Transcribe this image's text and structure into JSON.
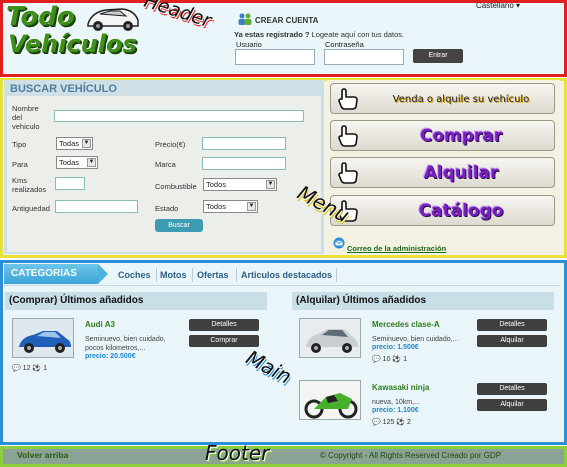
{
  "header": {
    "logo_line1": "Todo",
    "logo_line2": "Vehículos",
    "zone_label": "Header",
    "language": "Castellano ▾",
    "create_account": "CREAR CUENTA",
    "registered_prefix": "Ya estas registrado ?",
    "registered_suffix": " Logeate aquí con tus datos.",
    "user_label": "Usuario",
    "password_label": "Contraseña",
    "user_value": "",
    "password_value": "",
    "enter_label": "Entrar"
  },
  "search": {
    "title": "BUSCAR VEHÍCULO",
    "name_label": "Nombre del vehiculo",
    "name_value": "",
    "tipo_label": "Tipo",
    "tipo_value": "Todas",
    "para_label": "Para",
    "para_value": "Todas",
    "kms_label": "Kms realizados",
    "kms_value": "",
    "antiguedad_label": "Antiguedad",
    "antiguedad_value": "",
    "precio_label": "Precio(€)",
    "precio_value": "",
    "marca_label": "Marca",
    "marca_value": "",
    "combustible_label": "Combustible",
    "combustible_value": "Todos",
    "estado_label": "Estado",
    "estado_value": "Todos",
    "search_button": "Buscar"
  },
  "menu": {
    "zone_label": "Menu",
    "items": [
      {
        "label": "Venda o alquile su vehículo"
      },
      {
        "label": "Comprar"
      },
      {
        "label": "Alquilar"
      },
      {
        "label": "Catálogo"
      }
    ],
    "admin_mail": "Correo de la administración"
  },
  "main": {
    "zone_label": "Main",
    "categories_tab": "CATEGORIAS",
    "nav": [
      "Coches",
      "Motos",
      "Ofertas",
      "Articulos destacados"
    ],
    "buy_heading": "(Comprar) Últimos añadidos",
    "rent_heading": "(Alquilar) Últimos añadidos",
    "buy_items": [
      {
        "title": "Audi A3",
        "desc": "Seminuevo, bien cuidado, pocos kilometros,...",
        "price": "precio: 20.500€",
        "comments": "12",
        "views": "1",
        "details": "Detalles",
        "action": "Comprar"
      }
    ],
    "rent_items": [
      {
        "title": "Mercedes clase-A",
        "desc": "Seminuevo, bien cuidado,...",
        "price": "precio: 1.500€",
        "comments": "10",
        "views": "1",
        "details": "Detalles",
        "action": "Alquilar"
      },
      {
        "title": "Kawasaki ninja",
        "desc": "nueva, 10km,...",
        "price": "precio: 1.100€",
        "comments": "125",
        "views": "2",
        "details": "Detalles",
        "action": "Alquilar"
      }
    ]
  },
  "footer": {
    "zone_label": "Footer",
    "back_to_top": "Volver arriba",
    "copyright": "© Copyright - All Rights Reserved Creado por GDP"
  },
  "colors": {
    "header_border": "#e01f1f",
    "search_border": "#e6e23a",
    "main_border": "#2a8fd6",
    "footer_border": "#8bcf3a",
    "menu_text": "#7a1fc0",
    "accent_blue": "#3aa4d6"
  },
  "icons": [
    "user-group-icon",
    "hand-pointer-icon",
    "mail-icon",
    "comment-icon",
    "soccer-ball-icon",
    "car-logo-icon"
  ]
}
